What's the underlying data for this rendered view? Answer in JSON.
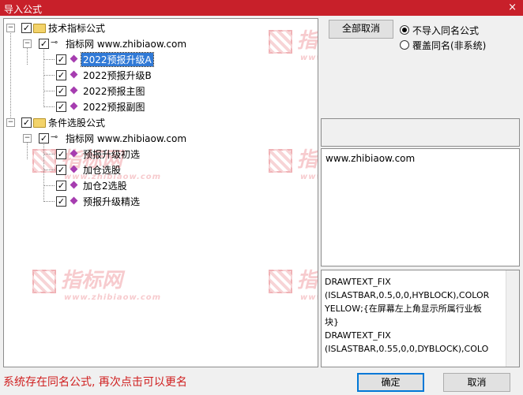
{
  "window": {
    "title": "导入公式",
    "close_label": "×"
  },
  "tree": {
    "groups": [
      {
        "label": "技术指标公式",
        "source": "指标网 www.zhibiaow.com",
        "items": [
          "2022预报升级A",
          "2022预报升级B",
          "2022预报主图",
          "2022预报副图"
        ]
      },
      {
        "label": "条件选股公式",
        "source": "指标网 www.zhibiaow.com",
        "items": [
          "预报升级初选",
          "加仓选股",
          "加仓2选股",
          "预报升级精选"
        ]
      }
    ],
    "selected_item": "2022预报升级A"
  },
  "watermark": {
    "brand": "指标网",
    "url": "www.zhibiaow.com"
  },
  "right": {
    "cancel_all_label": "全部取消",
    "radio_options": [
      {
        "label": "不导入同名公式",
        "selected": true
      },
      {
        "label": "覆盖同名(非系统)",
        "selected": false
      }
    ],
    "source_url": "www.zhibiaow.com",
    "code_text": "DRAWTEXT_FIX\n(ISLASTBAR,0.5,0,0,HYBLOCK),COLOR\nYELLOW;{在屏幕左上角显示所属行业板\n块}\nDRAWTEXT_FIX\n(ISLASTBAR,0.55,0,0,DYBLOCK),COLO"
  },
  "footer": {
    "status": "系统存在同名公式, 再次点击可以更名",
    "ok_label": "确定",
    "cancel_label": "取消"
  },
  "colors": {
    "titlebar": "#c8202a",
    "status": "#d02020",
    "selection": "#3079d6"
  }
}
